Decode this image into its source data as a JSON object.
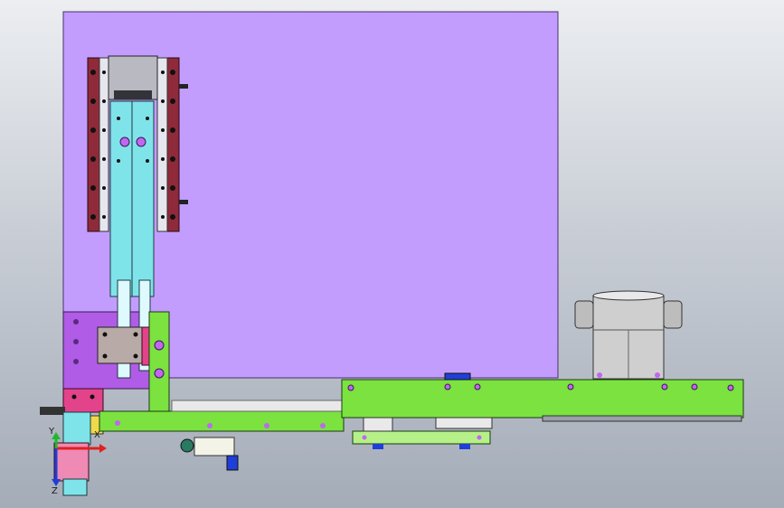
{
  "app": {
    "kind": "cad-viewport",
    "view": "front"
  },
  "colors": {
    "background_top": "#eceef1",
    "background_bottom": "#a4acb8",
    "plate_violet": "#c39dfd",
    "rail_maroon": "#8f2a3a",
    "slider_cyan": "#7fe4ea",
    "frame_green": "#7be23f",
    "block_magenta": "#b05ce6",
    "cylinder_gray": "#c9c9c9",
    "bolt_purple": "#c066f2",
    "axis_x": "#e0201f",
    "axis_y": "#1fb82a",
    "axis_z": "#1f3fd8"
  },
  "triad": {
    "x_label": "X",
    "y_label": "Y",
    "z_label": "Z"
  }
}
